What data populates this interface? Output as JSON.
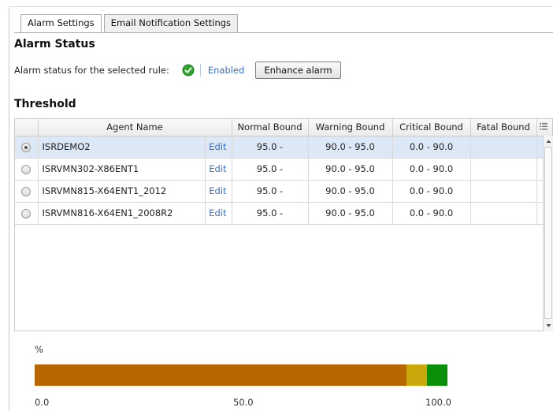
{
  "tabs": [
    {
      "label": "Alarm Settings",
      "active": true
    },
    {
      "label": "Email Notification Settings",
      "active": false
    }
  ],
  "alarm_status": {
    "title": "Alarm Status",
    "label": "Alarm status for the selected rule:",
    "status_icon": "check-circle-icon",
    "status_color": "#2ea52e",
    "status_text": "Enabled",
    "button_label": "Enhance alarm"
  },
  "threshold": {
    "title": "Threshold",
    "columns": [
      "Agent Name",
      "Normal Bound",
      "Warning Bound",
      "Critical Bound",
      "Fatal Bound"
    ],
    "rows": [
      {
        "name": "ISRDEMO2",
        "edit": "Edit",
        "normal": "95.0 -",
        "warning": "90.0 - 95.0",
        "critical": "0.0 - 90.0",
        "fatal": "",
        "selected": true
      },
      {
        "name": "ISRVMN302-X86ENT1",
        "edit": "Edit",
        "normal": "95.0 -",
        "warning": "90.0 - 95.0",
        "critical": "0.0 - 90.0",
        "fatal": "",
        "selected": false
      },
      {
        "name": "ISRVMN815-X64ENT1_2012",
        "edit": "Edit",
        "normal": "95.0 -",
        "warning": "90.0 - 95.0",
        "critical": "0.0 - 90.0",
        "fatal": "",
        "selected": false
      },
      {
        "name": "ISRVMN816-X64EN1_2008R2",
        "edit": "Edit",
        "normal": "95.0 -",
        "warning": "90.0 - 95.0",
        "critical": "0.0 - 90.0",
        "fatal": "",
        "selected": false
      }
    ]
  },
  "bound_bar": {
    "unit_label": "%",
    "min": 0,
    "max": 100,
    "segments": [
      {
        "name": "critical",
        "from": 0,
        "to": 90,
        "color": "#b86700"
      },
      {
        "name": "warning",
        "from": 90,
        "to": 95,
        "color": "#c8a80a"
      },
      {
        "name": "normal",
        "from": 95,
        "to": 100,
        "color": "#0a8f0a"
      }
    ],
    "ticks": [
      "0.0",
      "50.0",
      "100.0"
    ]
  },
  "colors": {
    "link": "#3a6fc5",
    "selected_row": "#dde8f6"
  }
}
